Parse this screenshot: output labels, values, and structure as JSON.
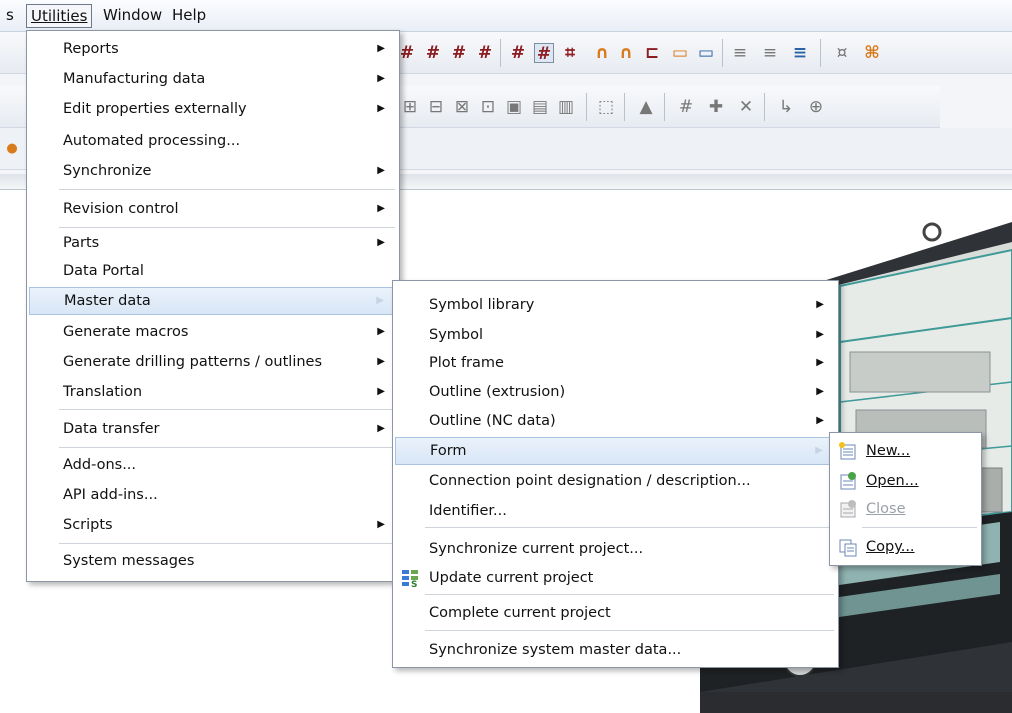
{
  "menubar": {
    "items": [
      {
        "label": "s",
        "active": false
      },
      {
        "label": "Utilities",
        "active": true
      },
      {
        "label": "Window",
        "active": false
      },
      {
        "label": "Help",
        "active": false
      }
    ]
  },
  "utilities_menu": {
    "items": [
      {
        "label": "Reports",
        "submenu": true
      },
      {
        "label": "Manufacturing data",
        "submenu": true
      },
      {
        "label": "Edit properties externally",
        "submenu": true
      },
      {
        "label": "Automated processing...",
        "submenu": false
      },
      {
        "label": "Synchronize",
        "submenu": true
      },
      {
        "label": "Revision control",
        "submenu": true
      },
      {
        "label": "Parts",
        "submenu": true
      },
      {
        "label": "Data Portal",
        "submenu": false
      },
      {
        "label": "Master data",
        "submenu": true,
        "highlighted": true
      },
      {
        "label": "Generate macros",
        "submenu": true
      },
      {
        "label": "Generate drilling patterns / outlines",
        "submenu": true
      },
      {
        "label": "Translation",
        "submenu": true
      },
      {
        "label": "Data transfer",
        "submenu": true
      },
      {
        "label": "Add-ons...",
        "submenu": false
      },
      {
        "label": "API add-ins...",
        "submenu": false
      },
      {
        "label": "Scripts",
        "submenu": true
      },
      {
        "label": "System messages",
        "submenu": false
      }
    ]
  },
  "master_data_menu": {
    "items": [
      {
        "label": "Symbol library",
        "submenu": true
      },
      {
        "label": "Symbol",
        "submenu": true
      },
      {
        "label": "Plot frame",
        "submenu": true
      },
      {
        "label": "Outline (extrusion)",
        "submenu": true
      },
      {
        "label": "Outline (NC data)",
        "submenu": true
      },
      {
        "label": "Form",
        "submenu": true,
        "highlighted": true
      },
      {
        "label": "Connection point designation / description...",
        "submenu": false
      },
      {
        "label": "Identifier...",
        "submenu": false
      },
      {
        "label": "Synchronize current project...",
        "submenu": false
      },
      {
        "label": "Update current project",
        "submenu": false,
        "icon": "update-project-icon"
      },
      {
        "label": "Complete current project",
        "submenu": false
      },
      {
        "label": "Synchronize system master data...",
        "submenu": false
      }
    ]
  },
  "form_menu": {
    "items": [
      {
        "label": "New...",
        "icon": "new-form-icon",
        "disabled": false
      },
      {
        "label": "Open...",
        "icon": "open-form-icon",
        "disabled": false
      },
      {
        "label": "Close",
        "icon": "close-form-icon",
        "disabled": true
      },
      {
        "label": "Copy...",
        "icon": "copy-form-icon",
        "disabled": false
      }
    ]
  },
  "colors": {
    "menu_highlight": "#d8e6f6",
    "menu_border": "#8b95a3",
    "cabinet_teal": "#3f9a98",
    "toolbar_icon_red": "#8c1d22"
  }
}
